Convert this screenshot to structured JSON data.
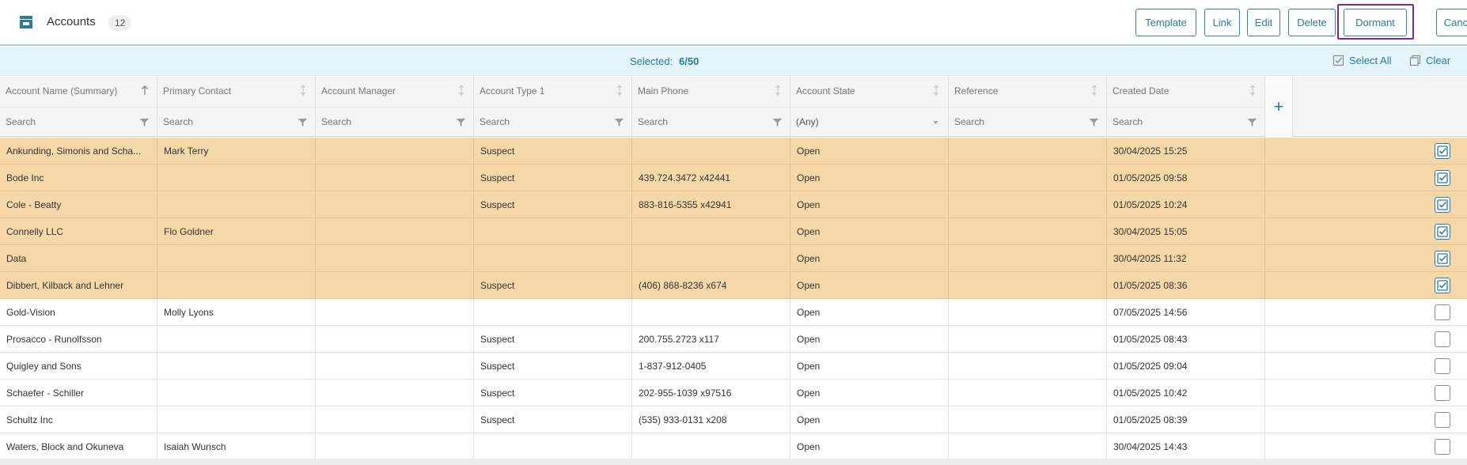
{
  "header": {
    "title": "Accounts",
    "count": "12",
    "buttons": {
      "template": "Template",
      "link": "Link",
      "edit": "Edit",
      "delete": "Delete",
      "dormant": "Dormant",
      "cancel": "Cancel"
    }
  },
  "selection": {
    "label": "Selected:",
    "value": "6/50",
    "select_all": "Select All",
    "clear": "Clear"
  },
  "columns": [
    {
      "label": "Account Name (Summary)",
      "filter": "Search",
      "sort": "ascending"
    },
    {
      "label": "Primary Contact",
      "filter": "Search",
      "sort": "none"
    },
    {
      "label": "Account Manager",
      "filter": "Search",
      "sort": "none"
    },
    {
      "label": "Account Type 1",
      "filter": "Search",
      "sort": "none"
    },
    {
      "label": "Main Phone",
      "filter": "Search",
      "sort": "none"
    },
    {
      "label": "Account State",
      "filter": "(Any)",
      "sort": "none"
    },
    {
      "label": "Reference",
      "filter": "Search",
      "sort": "none"
    },
    {
      "label": "Created Date",
      "filter": "Search",
      "sort": "none"
    }
  ],
  "add_column_label": "+",
  "rows": [
    {
      "name": "Ankunding, Simonis and Scha...",
      "contact": "Mark Terry",
      "manager": "",
      "type": "Suspect",
      "phone": "",
      "state": "Open",
      "reference": "",
      "created": "30/04/2025 15:25",
      "selected": true
    },
    {
      "name": "Bode Inc",
      "contact": "",
      "manager": "",
      "type": "Suspect",
      "phone": "439.724.3472 x42441",
      "state": "Open",
      "reference": "",
      "created": "01/05/2025 09:58",
      "selected": true
    },
    {
      "name": "Cole - Beatty",
      "contact": "",
      "manager": "",
      "type": "Suspect",
      "phone": "883-816-5355 x42941",
      "state": "Open",
      "reference": "",
      "created": "01/05/2025 10:24",
      "selected": true
    },
    {
      "name": "Connelly LLC",
      "contact": "Flo Goldner",
      "manager": "",
      "type": "",
      "phone": "",
      "state": "Open",
      "reference": "",
      "created": "30/04/2025 15:05",
      "selected": true
    },
    {
      "name": "Data",
      "contact": "",
      "manager": "",
      "type": "",
      "phone": "",
      "state": "Open",
      "reference": "",
      "created": "30/04/2025 11:32",
      "selected": true
    },
    {
      "name": "Dibbert, Kilback and Lehner",
      "contact": "",
      "manager": "",
      "type": "Suspect",
      "phone": "(406) 868-8236 x674",
      "state": "Open",
      "reference": "",
      "created": "01/05/2025 08:36",
      "selected": true
    },
    {
      "name": "Gold-Vision",
      "contact": "Molly Lyons",
      "manager": "",
      "type": "",
      "phone": "",
      "state": "Open",
      "reference": "",
      "created": "07/05/2025 14:56",
      "selected": false
    },
    {
      "name": "Prosacco - Runolfsson",
      "contact": "",
      "manager": "",
      "type": "Suspect",
      "phone": "200.755.2723 x117",
      "state": "Open",
      "reference": "",
      "created": "01/05/2025 08:43",
      "selected": false
    },
    {
      "name": "Quigley and Sons",
      "contact": "",
      "manager": "",
      "type": "Suspect",
      "phone": "1-837-912-0405",
      "state": "Open",
      "reference": "",
      "created": "01/05/2025 09:04",
      "selected": false
    },
    {
      "name": "Schaefer - Schiller",
      "contact": "",
      "manager": "",
      "type": "Suspect",
      "phone": "202-955-1039 x97516",
      "state": "Open",
      "reference": "",
      "created": "01/05/2025 10:42",
      "selected": false
    },
    {
      "name": "Schultz Inc",
      "contact": "",
      "manager": "",
      "type": "Suspect",
      "phone": "(535) 933-0131 x208",
      "state": "Open",
      "reference": "",
      "created": "01/05/2025 08:39",
      "selected": false
    },
    {
      "name": "Waters, Block and Okuneva",
      "contact": "Isaiah Wunsch",
      "manager": "",
      "type": "",
      "phone": "",
      "state": "Open",
      "reference": "",
      "created": "30/04/2025 14:43",
      "selected": false
    }
  ],
  "colors": {
    "accent": "#2a7ca0",
    "selected_row": "#f6d7a8",
    "selection_bar": "#e3f4fa",
    "highlight_outline": "#7b2a9e"
  },
  "icons": {
    "app": "accounts-store-icon",
    "select_all": "checkbox-select-icon",
    "clear": "clear-copy-icon",
    "filter": "funnel-icon",
    "sort": "sort-arrow-icon"
  }
}
